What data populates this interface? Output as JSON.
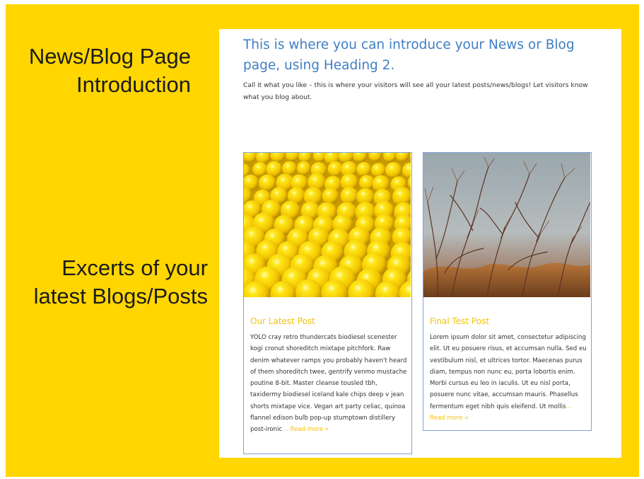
{
  "annotations": {
    "intro": {
      "line1": "News/Blog Page",
      "line2": "Introduction"
    },
    "excerpts": {
      "line1": "Excerts of your",
      "line2": "latest Blogs/Posts"
    }
  },
  "intro": {
    "heading": "This is where you can introduce your News or Blog page, using Heading 2.",
    "text": "Call it what you like – this is where your visitors will see all your latest posts/news/blogs! Let visitors know what you blog about."
  },
  "posts": [
    {
      "title": "Our Latest Post",
      "excerpt": "YOLO cray retro thundercats biodiesel scenester kogi cronut shoreditch mixtape pitchfork. Raw denim whatever ramps you probably haven't heard of them shoreditch twee, gentrify venmo mustache poutine 8-bit. Master cleanse tousled tbh, taxidermy biodiesel iceland kale chips deep v jean shorts mixtape vice. Vegan art party celiac, quinoa flannel edison bulb pop-up stumptown distillery post-ironic",
      "ellipsis": "…",
      "read_more": "Read more »",
      "image": "yellow-balls-photo"
    },
    {
      "title": "Final Test Post",
      "excerpt": "Lorem ipsum dolor sit amet, consectetur adipiscing elit. Ut eu posuere risus, et accumsan nulla. Sed eu vestibulum nisl, et ultrices tortor. Maecenas purus diam, tempus non nunc eu, porta lobortis enim. Morbi cursus eu leo in iaculis. Ut eu nisl porta, posuere nunc vitae, accumsan mauris. Phasellus fermentum eget nibh quis eleifend. Ut mollis",
      "ellipsis": "…",
      "read_more": "Read more »",
      "image": "bare-branches-photo"
    }
  ],
  "colors": {
    "background": "#ffd600",
    "heading": "#3f7fc3",
    "accent": "#f4c20d",
    "card_border": "#7ea3d6"
  }
}
